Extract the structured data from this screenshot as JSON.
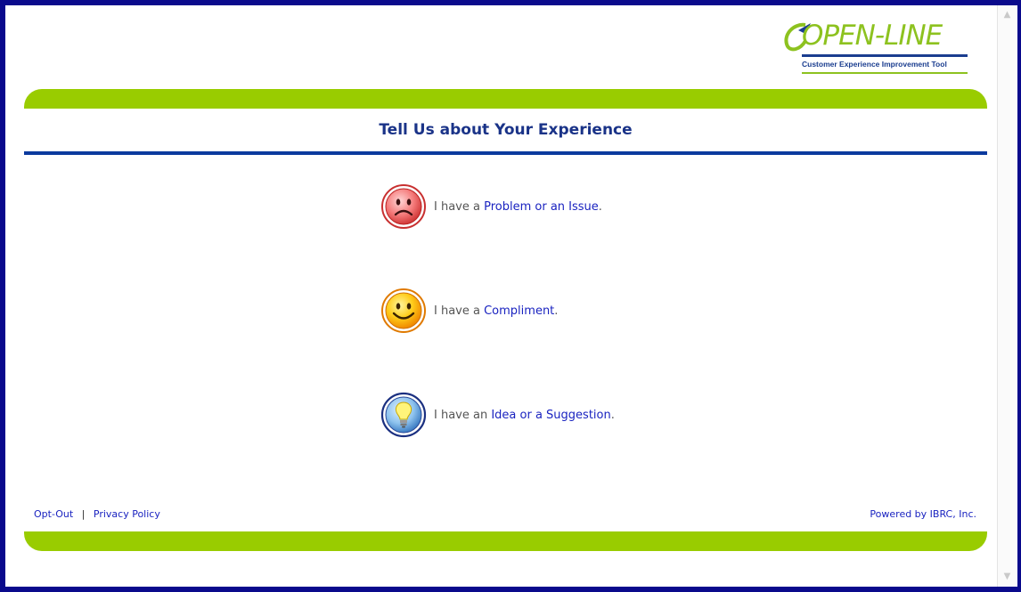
{
  "logo": {
    "wordmark": "OPEN-LINE",
    "tagline": "Customer Experience Improvement Tool",
    "colors": {
      "green": "#8dc21f",
      "blue": "#1a3d8f"
    }
  },
  "heading": "Tell Us about Your Experience",
  "options": [
    {
      "prefix": "I have a ",
      "link": "Problem or an Issue",
      "suffix": ".",
      "icon": "sad-face-icon"
    },
    {
      "prefix": "I have a ",
      "link": "Compliment",
      "suffix": ".",
      "icon": "smiley-face-icon"
    },
    {
      "prefix": "I have an ",
      "link": "Idea or a Suggestion",
      "suffix": ".",
      "icon": "lightbulb-icon"
    }
  ],
  "footer": {
    "opt_out": "Opt-Out",
    "separator": "|",
    "privacy": "Privacy Policy",
    "powered_by": "Powered by IBRC, Inc."
  },
  "colors": {
    "bar_green": "#99cc00",
    "rule_blue": "#0b3a9e",
    "frame_blue": "#0a0a8c",
    "link_blue": "#1a23c0",
    "heading_blue": "#1a3388"
  }
}
